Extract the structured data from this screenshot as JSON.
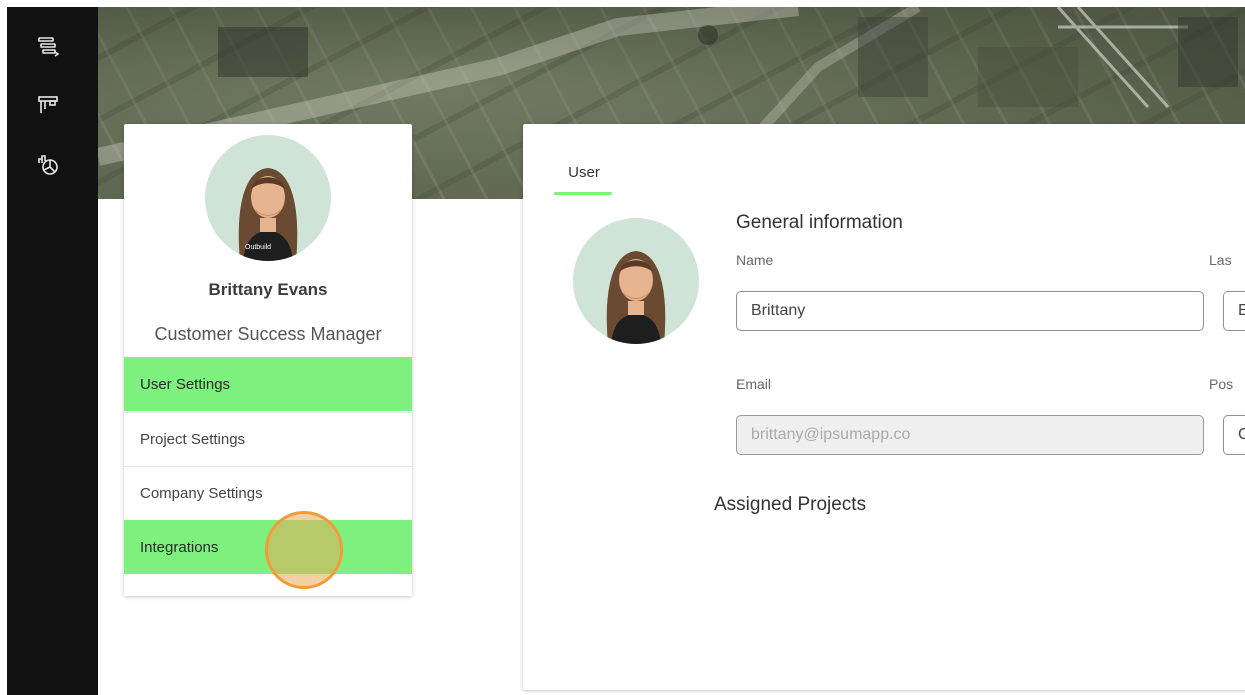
{
  "profile": {
    "name": "Brittany Evans",
    "role": "Customer Success Manager",
    "shirt_text": "Outbuild"
  },
  "menu": {
    "items": [
      {
        "label": "User Settings",
        "active": true
      },
      {
        "label": "Project Settings",
        "active": false
      },
      {
        "label": "Company Settings",
        "active": false
      },
      {
        "label": "Integrations",
        "active": true
      }
    ]
  },
  "tabs": [
    {
      "label": "User",
      "active": true
    }
  ],
  "general": {
    "title": "General information",
    "name_label": "Name",
    "name_value": "Brittany",
    "last_name_label_partial": "Las",
    "last_name_value_partial": "E",
    "email_label": "Email",
    "email_value": "brittany@ipsumapp.co",
    "position_label_partial": "Pos",
    "position_value_partial": "C"
  },
  "assigned": {
    "title": "Assigned Projects"
  },
  "colors": {
    "accent": "#7ef07e",
    "rail": "#111111",
    "click_indicator": "#f39a3a"
  },
  "icons": [
    "gantt-list-icon",
    "board-icon",
    "analytics-icon"
  ]
}
